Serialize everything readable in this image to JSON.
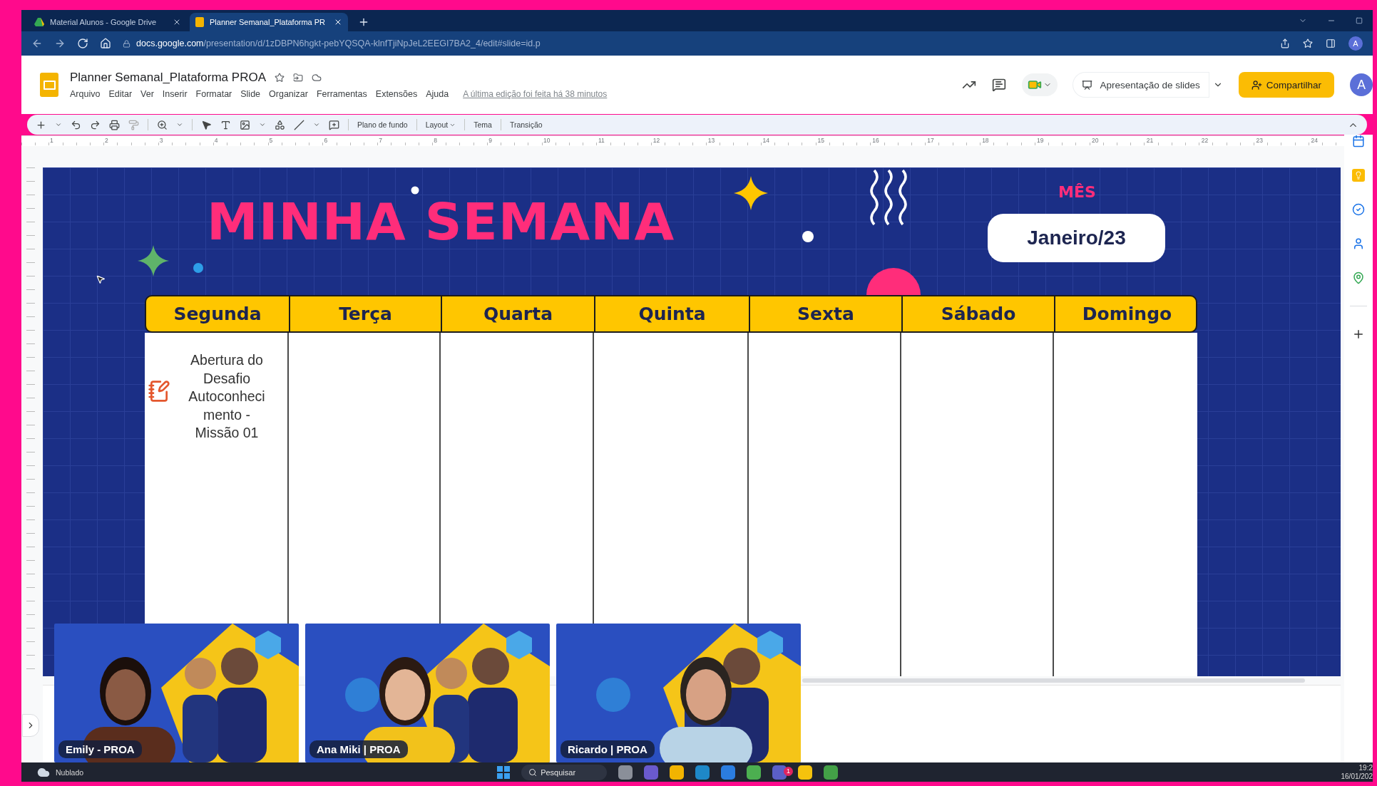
{
  "browser": {
    "tabs": [
      {
        "title": "Material Alunos - Google Drive",
        "selected": false
      },
      {
        "title": "Planner Semanal_Plataforma PR",
        "selected": true
      }
    ],
    "url_host": "docs.google.com",
    "url_path": "/presentation/d/1zDBPN6hgkt-pebYQSQA-klnfTjiNpJeL2EEGI7BA2_4/edit#slide=id.p",
    "avatar": "A"
  },
  "document": {
    "title": "Planner Semanal_Plataforma PROA",
    "menu": [
      "Arquivo",
      "Editar",
      "Ver",
      "Inserir",
      "Formatar",
      "Slide",
      "Organizar",
      "Ferramentas",
      "Extensões",
      "Ajuda"
    ],
    "last_edit": "A última edição foi feita há 38 minutos",
    "present_button": "Apresentação de slides",
    "share_button": "Compartilhar",
    "avatar": "A"
  },
  "toolbar": {
    "buttons": [
      "Plano de fundo",
      "Layout",
      "Tema",
      "Transição"
    ]
  },
  "ruler": [
    "1",
    "2",
    "3",
    "4",
    "5",
    "6",
    "7",
    "8",
    "9",
    "10",
    "11",
    "12",
    "13",
    "14",
    "15",
    "16",
    "17",
    "18",
    "19",
    "20",
    "21",
    "22",
    "23",
    "24"
  ],
  "slide": {
    "title": "MINHA SEMANA",
    "month_label": "MÊS",
    "month": "Janeiro/23",
    "days": [
      {
        "name": "Segunda",
        "entry": [
          "Abertura do",
          "Desafio",
          "Autoconheci",
          "mento -",
          "Missão 01"
        ]
      },
      {
        "name": "Terça"
      },
      {
        "name": "Quarta"
      },
      {
        "name": "Quinta"
      },
      {
        "name": "Sexta"
      },
      {
        "name": "Sábado"
      },
      {
        "name": "Domingo"
      }
    ]
  },
  "video_tiles": [
    {
      "name": "Emily - PROA"
    },
    {
      "name": "Ana Miki | PROA"
    },
    {
      "name": "Ricardo | PROA"
    }
  ],
  "taskbar": {
    "weather": "Nublado",
    "search": "Pesquisar",
    "badge": "1",
    "time": "19:2",
    "date": "16/01/202"
  }
}
